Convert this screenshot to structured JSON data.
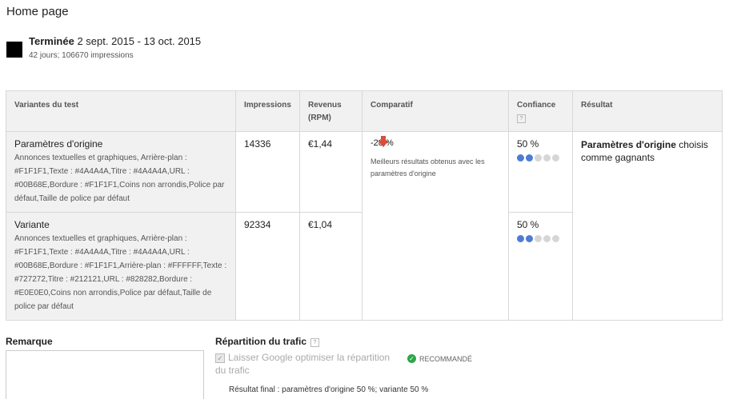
{
  "header": {
    "breadcrumb": "Home page"
  },
  "status": {
    "state_label": "Terminée",
    "date_range": "2 sept. 2015 - 13 oct. 2015",
    "summary": "42 jours; 106670 impressions",
    "square_color": "#000000"
  },
  "table": {
    "headers": {
      "variant": "Variantes du test",
      "impressions": "Impressions",
      "revenue_line1": "Revenus",
      "revenue_line2": "(RPM)",
      "comparison": "Comparatif",
      "confidence": "Confiance",
      "confidence_help": "?",
      "result": "Résultat"
    },
    "rows": [
      {
        "name": "Paramètres d'origine",
        "description": "Annonces textuelles et graphiques, Arrière-plan : #F1F1F1,Texte : #4A4A4A,Titre : #4A4A4A,URL : #00B68E,Bordure : #F1F1F1,Coins non arrondis,Police par défaut,Taille de police par défaut",
        "impressions": "14336",
        "revenue": "€1,44",
        "confidence": "50 %",
        "confidence_level": 2,
        "confidence_max": 5
      },
      {
        "name": "Variante",
        "description": "Annonces textuelles et graphiques, Arrière-plan : #F1F1F1,Texte : #4A4A4A,Titre : #4A4A4A,URL : #00B68E,Bordure : #F1F1F1,Arrière-plan : #FFFFFF,Texte : #727272,Titre : #212121,URL : #828282,Bordure : #E0E0E0,Coins non arrondis,Police par défaut,Taille de police par défaut",
        "impressions": "92334",
        "revenue": "€1,04",
        "confidence": "50 %",
        "confidence_level": 2,
        "confidence_max": 5
      }
    ],
    "comparison": {
      "value": "-28 %",
      "text": "Meilleurs résultats obtenus avec les paramètres d'origine",
      "arrow_icon": "down-arrow-icon",
      "arrow_color": "#dd4b39"
    },
    "result": {
      "winner": "Paramètres d'origine",
      "text": "choisis comme gagnants"
    },
    "colors": {
      "dot_on": "#4e7bd6",
      "dot_off": "#d6d6d6"
    }
  },
  "remark": {
    "title": "Remarque",
    "value": ""
  },
  "traffic": {
    "title": "Répartition du trafic",
    "help": "?",
    "option_label_line1": "Laisser Google optimiser la répartition",
    "option_label_line2": "du trafic",
    "option_checked": true,
    "recommended_label": "RECOMMANDÉ",
    "final_result": "Résultat final : paramètres d'origine 50 %; variante 50 %"
  }
}
